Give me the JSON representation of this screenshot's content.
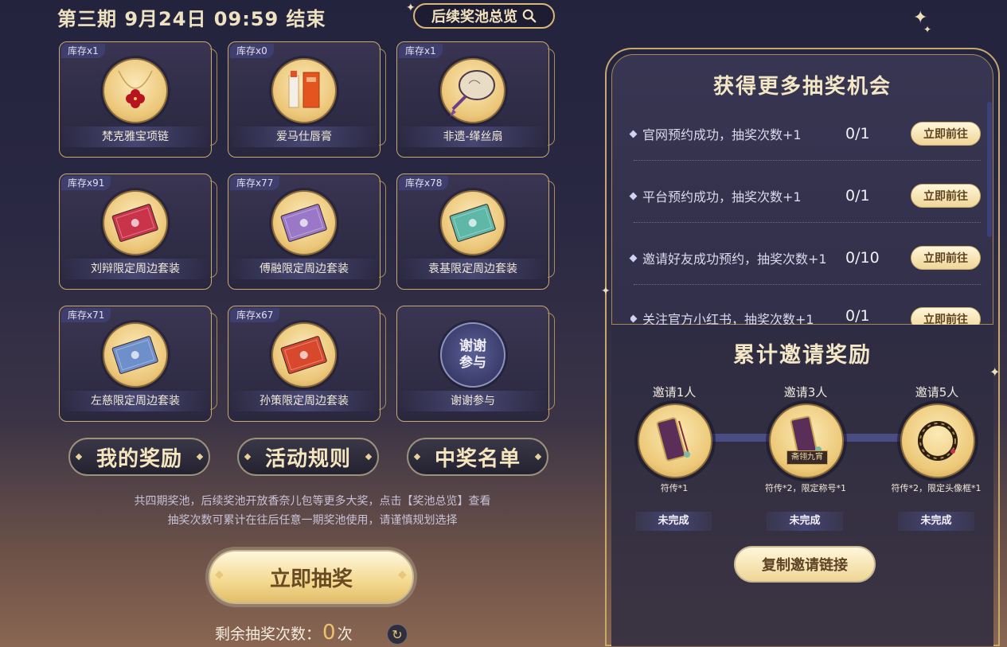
{
  "header": {
    "period_text": "第三期  9月24日  09:59  结束",
    "overview_button": "后续奖池总览"
  },
  "prizes": [
    {
      "stock": "库存x1",
      "name": "梵克雅宝项链",
      "kind": "necklace"
    },
    {
      "stock": "库存x0",
      "name": "爱马仕唇膏",
      "kind": "lipstick"
    },
    {
      "stock": "库存x1",
      "name": "非遗-缂丝扇",
      "kind": "fan"
    },
    {
      "stock": "库存x91",
      "name": "刘辩限定周边套装",
      "kind": "envelope",
      "color": "#c9344a"
    },
    {
      "stock": "库存x77",
      "name": "傅融限定周边套装",
      "kind": "envelope",
      "color": "#9a78c7"
    },
    {
      "stock": "库存x78",
      "name": "袁基限定周边套装",
      "kind": "envelope",
      "color": "#5fb7a7"
    },
    {
      "stock": "库存x71",
      "name": "左慈限定周边套装",
      "kind": "envelope",
      "color": "#6f8fcb"
    },
    {
      "stock": "库存x67",
      "name": "孙策限定周边套装",
      "kind": "envelope",
      "color": "#d8482c"
    },
    {
      "stock": "",
      "name": "谢谢参与",
      "kind": "thanks",
      "badge": "谢谢参与"
    }
  ],
  "buttons": {
    "my_rewards": "我的奖励",
    "rules": "活动规则",
    "winners": "中奖名单",
    "draw": "立即抽奖"
  },
  "notes": {
    "line1": "共四期奖池，后续奖池开放香奈儿包等更多大奖，点击【奖池总览】查看",
    "line2": "抽奖次数可累计在往后任意一期奖池使用，请谨慎规划选择"
  },
  "remaining": {
    "label": "剩余抽奖次数：",
    "count": "0",
    "unit": "次"
  },
  "tasks_panel": {
    "title": "获得更多抽奖机会",
    "tasks": [
      {
        "label": "官网预约成功，抽奖次数+1",
        "progress": "0/1",
        "button": "立即前往"
      },
      {
        "label": "平台预约成功，抽奖次数+1",
        "progress": "0/1",
        "button": "立即前往"
      },
      {
        "label": "邀请好友成功预约，抽奖次数+1",
        "progress": "0/10",
        "button": "立即前往"
      },
      {
        "label": "关注官方小红书，抽奖次数+1",
        "progress": "0/1",
        "button": "立即前往"
      }
    ]
  },
  "invite_panel": {
    "title": "累计邀请奖励",
    "tiers": [
      {
        "label": "邀请1人",
        "desc": "符传*1",
        "status": "未完成"
      },
      {
        "label": "邀请3人",
        "desc": "符传*2，限定称号*1",
        "status": "未完成",
        "badge": "斋翎九宵"
      },
      {
        "label": "邀请5人",
        "desc": "符传*2，限定头像框*1",
        "status": "未完成"
      }
    ],
    "copy_button": "复制邀请链接"
  }
}
